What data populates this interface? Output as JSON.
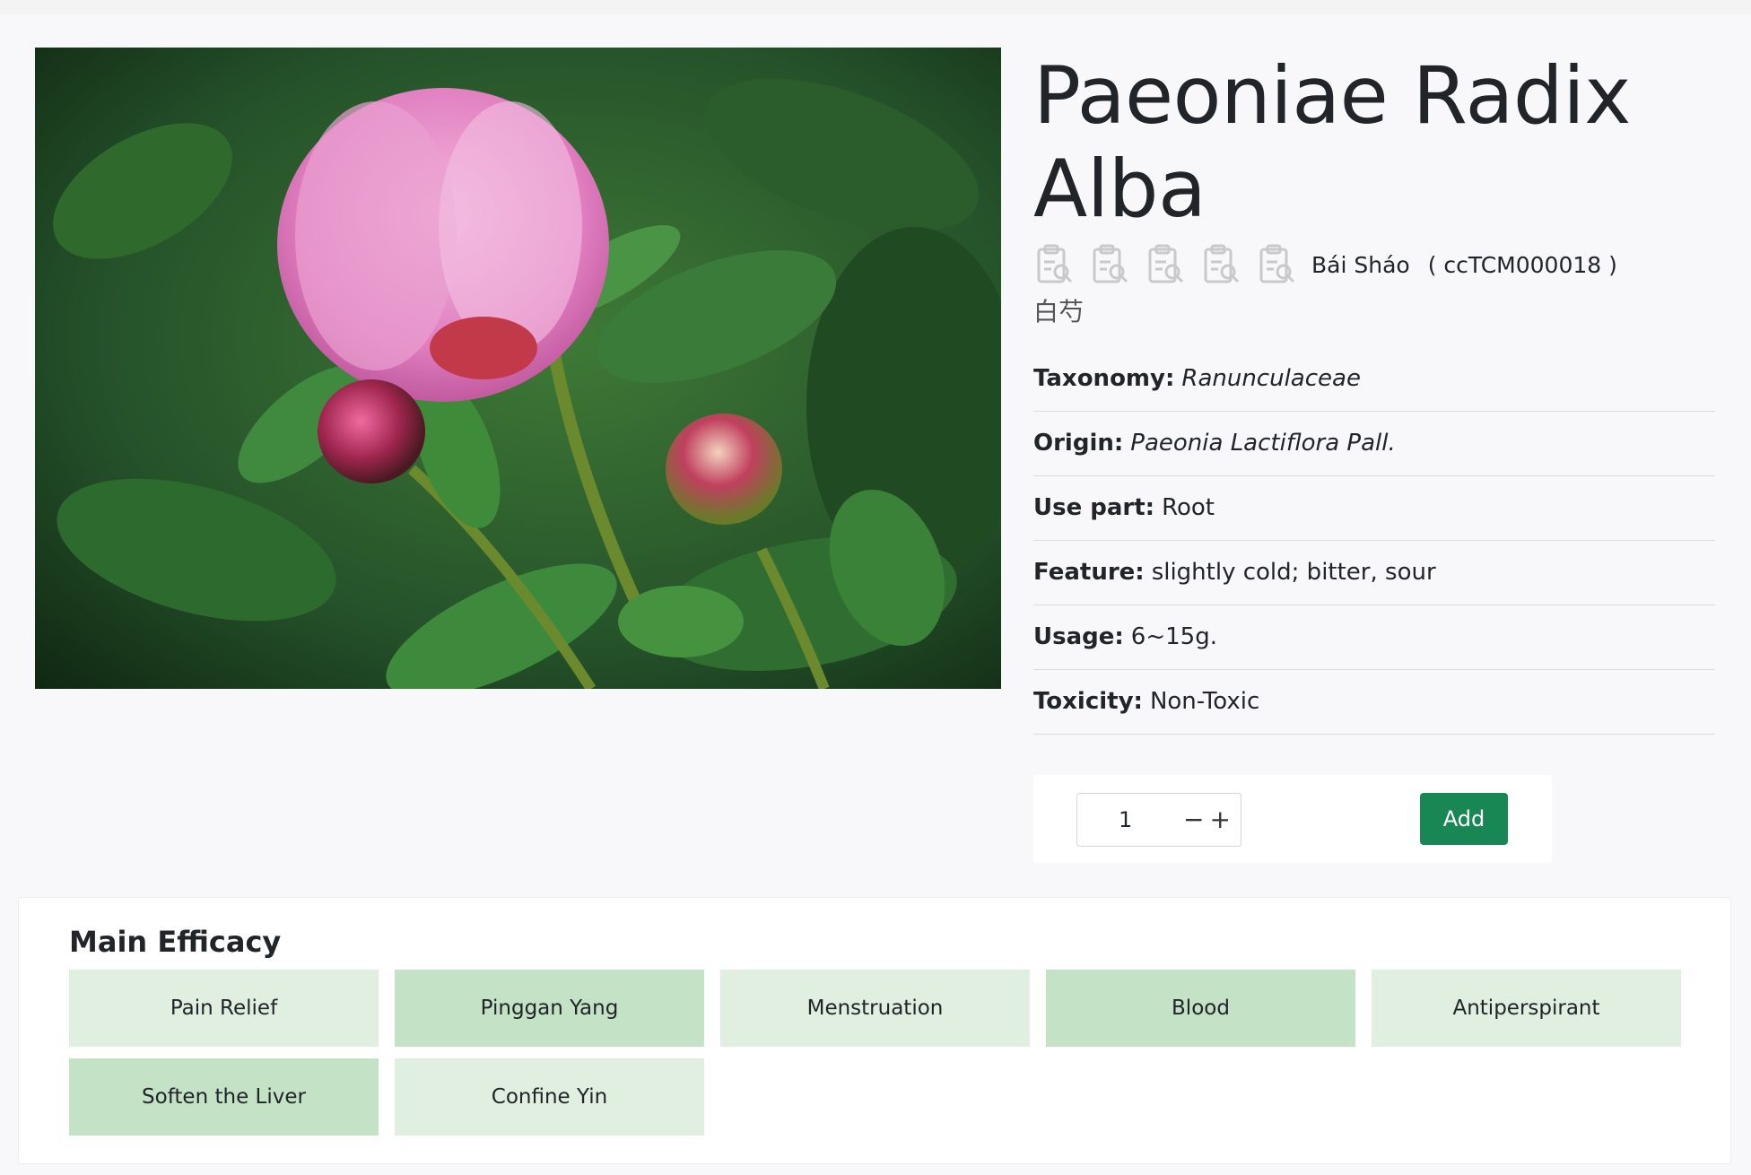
{
  "herb": {
    "title": "Paeoniae Radix Alba",
    "pinyin": "Bái Sháo",
    "tcm_id": "( ccTCM000018 )",
    "chinese_name": "白芍",
    "icon_count": 5
  },
  "properties": [
    {
      "key": "Taxonomy:",
      "value": "Ranunculaceae",
      "italic": true
    },
    {
      "key": "Origin:",
      "value": "Paeonia Lactiflora Pall.",
      "italic": true
    },
    {
      "key": "Use part:",
      "value": "Root",
      "italic": false
    },
    {
      "key": "Feature:",
      "value": "slightly cold; bitter, sour",
      "italic": false
    },
    {
      "key": "Usage:",
      "value": "6~15g.",
      "italic": false
    },
    {
      "key": "Toxicity:",
      "value": "Non-Toxic",
      "italic": false
    }
  ],
  "cart": {
    "quantity": "1",
    "minus": "−",
    "plus": "+",
    "add_label": "Add"
  },
  "efficacy": {
    "heading": "Main Efficacy",
    "tags": [
      {
        "label": "Pain Relief",
        "shade": "light"
      },
      {
        "label": "Pinggan Yang",
        "shade": "dark"
      },
      {
        "label": "Menstruation",
        "shade": "light"
      },
      {
        "label": "Blood",
        "shade": "dark"
      },
      {
        "label": "Antiperspirant",
        "shade": "light"
      },
      {
        "label": "Soften the Liver",
        "shade": "dark"
      },
      {
        "label": "Confine Yin",
        "shade": "light"
      }
    ]
  },
  "colors": {
    "accent": "#198754",
    "tag_light": "#e0efe0",
    "tag_dark": "#c4e2c5"
  },
  "icons": [
    "herb-clipboard-icon"
  ]
}
